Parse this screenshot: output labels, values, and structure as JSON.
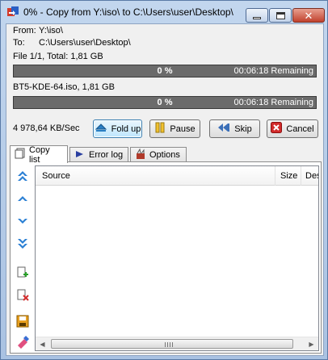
{
  "window": {
    "title": "0% - Copy from Y:\\iso\\ to C:\\Users\\user\\Desktop\\"
  },
  "info": {
    "from_label": "From:",
    "from_value": "Y:\\iso\\",
    "to_label": "To:",
    "to_value": "C:\\Users\\user\\Desktop\\",
    "file_summary": "File 1/1, Total: 1,81 GB",
    "current_file": "BT5-KDE-64.iso, 1,81 GB",
    "speed": "4 978,64 KB/Sec"
  },
  "total_progress": {
    "percent_text": "0 %",
    "fraction": 0,
    "remaining": "00:06:18 Remaining"
  },
  "file_progress": {
    "percent_text": "0 %",
    "fraction": 0,
    "remaining": "00:06:18 Remaining"
  },
  "buttons": {
    "fold_up": "Fold up",
    "pause": "Pause",
    "skip": "Skip",
    "cancel": "Cancel"
  },
  "tabs": {
    "copy_list": "Copy list",
    "error_log": "Error log",
    "options": "Options"
  },
  "list": {
    "columns": {
      "source": "Source",
      "size": "Size",
      "destination": "Destin"
    }
  },
  "colors": {
    "progress_bg": "#6b6b6b",
    "progress_fill": "#2f7d2f",
    "accent_blue": "#1a5fb4",
    "cancel_red": "#d22a2a"
  },
  "icons": {
    "app": "teracopy-icon",
    "fold_up": "fold-up-icon",
    "pause": "pause-icon",
    "skip": "skip-icon",
    "cancel": "cancel-icon",
    "copy_list": "copy-list-icon",
    "error_log": "error-log-icon",
    "options": "options-icon",
    "move_top": "move-top-icon",
    "move_up": "move-up-icon",
    "move_down": "move-down-icon",
    "move_bottom": "move-bottom-icon",
    "add_file": "add-file-icon",
    "remove_file": "remove-file-icon",
    "save_list": "save-list-icon",
    "clear_list": "clear-list-icon"
  }
}
